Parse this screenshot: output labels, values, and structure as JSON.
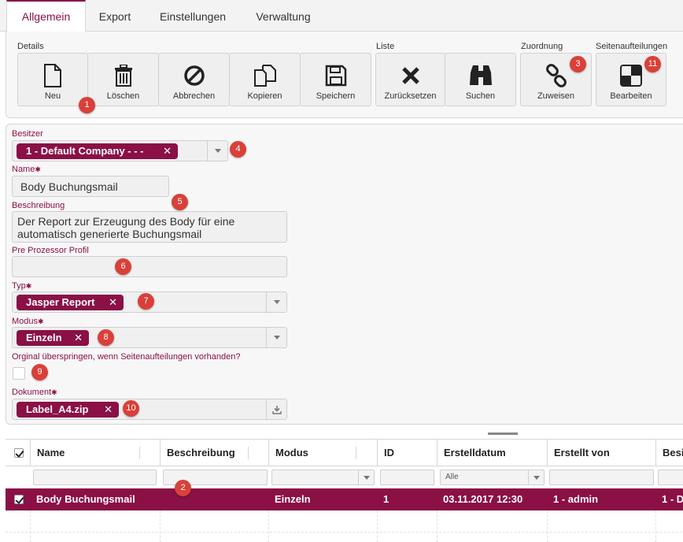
{
  "tabs": [
    "Allgemein",
    "Export",
    "Einstellungen",
    "Verwaltung"
  ],
  "ribbon": {
    "groups": {
      "details": "Details",
      "liste": "Liste",
      "zuordnung": "Zuordnung",
      "seiten": "Seitenaufteilungen"
    },
    "buttons": {
      "neu": "Neu",
      "loeschen": "Löschen",
      "abbrechen": "Abbrechen",
      "kopieren": "Kopieren",
      "speichern": "Speichern",
      "zuruecksetzen": "Zurücksetzen",
      "suchen": "Suchen",
      "zuweisen": "Zuweisen",
      "bearbeiten": "Bearbeiten"
    }
  },
  "badges": {
    "b1": "1",
    "b2": "2",
    "b3": "3",
    "b4": "4",
    "b5": "5",
    "b6": "6",
    "b7": "7",
    "b8": "8",
    "b9": "9",
    "b10": "10",
    "b11": "11"
  },
  "form": {
    "besitzer": {
      "label": "Besitzer",
      "value": "1 - Default Company - - -"
    },
    "name": {
      "label": "Name",
      "value": "Body Buchungsmail"
    },
    "beschreibung": {
      "label": "Beschreibung",
      "line1": "Der Report zur Erzeugung des Body für eine",
      "line2": "automatisch generierte Buchungsmail"
    },
    "preprozessor": {
      "label": "Pre Prozessor Profil",
      "value": ""
    },
    "typ": {
      "label": "Typ",
      "value": "Jasper Report"
    },
    "modus": {
      "label": "Modus",
      "value": "Einzeln"
    },
    "original": {
      "label": "Orginal überspringen, wenn Seitenaufteilungen vorhanden?",
      "checked": false
    },
    "dokument": {
      "label": "Dokument",
      "value": "Label_A4.zip"
    },
    "required_mark": "✱",
    "remove_mark": "✕"
  },
  "grid": {
    "headers": [
      "Name",
      "Beschreibung",
      "Modus",
      "ID",
      "Erstelldatum",
      "Erstellt von",
      "Besi"
    ],
    "filter_alle": "Alle",
    "rows": [
      {
        "selected": true,
        "name": "Body Buchungsmail",
        "beschreibung": "",
        "modus": "Einzeln",
        "id": "1",
        "erstelldatum": "03.11.2017 12:30",
        "erstellt_von": "1 - admin",
        "besitzer": "1 - D"
      }
    ]
  },
  "colors": {
    "accent": "#8a1046",
    "badge": "#d9403a"
  }
}
